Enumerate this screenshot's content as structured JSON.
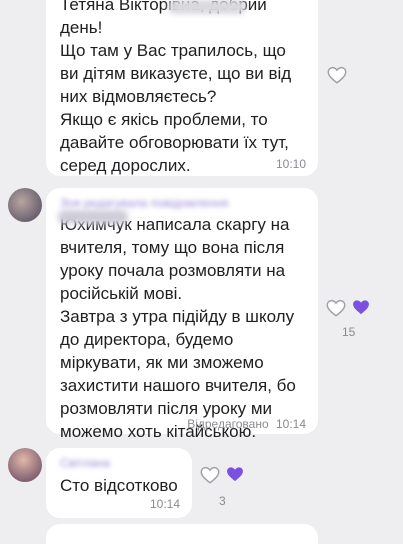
{
  "messages": [
    {
      "text": "Тетяна Вікторівна, добрий\nдень!\nЩо там у Вас трапилось, що\nви дітям виказуєте, що ви від\nних відмовляєтесь?\nЯкщо є якісь проблеми, то\nдавайте обговорювати їх тут,\nсеред дорослих.",
      "time": "10:10"
    },
    {
      "sender": "Зоя редагувала повідомлення",
      "text": "Юхимчук написала скаргу на\nвчителя, тому що вона після\nуроку почала розмовляти на\nросійській мові.\nЗавтра з утра підійду в школу\nдо директора, будемо\nміркувати, як ми зможемо\nзахистити нашого вчителя, бо\nрозмовляти після уроку ми\nможемо хоть кітайською.",
      "edited": "Відредаговано",
      "time": "10:14",
      "likes": "15"
    },
    {
      "sender": "Світлана",
      "text": "Сто відсотково",
      "time": "10:14",
      "likes": "3"
    }
  ],
  "colors": {
    "background": "#eeeef1",
    "bubble": "#ffffff",
    "heart_filled": "#7b4fe0",
    "heart_outline": "#a0a0a8"
  }
}
